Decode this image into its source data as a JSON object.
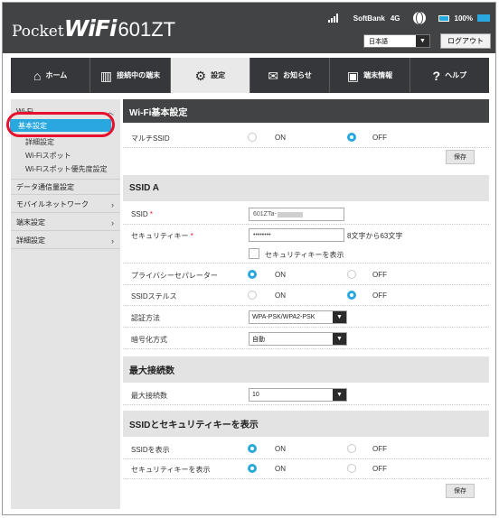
{
  "brand": {
    "pocket": "Pocket",
    "wifi": "WiFi",
    "model": "601ZT"
  },
  "status": {
    "carrier": "SoftBank",
    "network": "4G",
    "battery": "100%"
  },
  "header": {
    "language": "日本語",
    "logout": "ログアウト"
  },
  "nav": [
    {
      "label": "ホーム",
      "icon": "home-icon",
      "glyph": "⌂"
    },
    {
      "label": "接続中の端末",
      "icon": "devices-icon",
      "glyph": "▥"
    },
    {
      "label": "設定",
      "icon": "gear-icon",
      "glyph": "⚙"
    },
    {
      "label": "お知らせ",
      "icon": "mail-icon",
      "glyph": "✉"
    },
    {
      "label": "端末情報",
      "icon": "device-info-icon",
      "glyph": "▣"
    },
    {
      "label": "ヘルプ",
      "icon": "help-icon",
      "glyph": "?"
    }
  ],
  "sidebar": {
    "wifi": "Wi-Fi",
    "sub": [
      "基本設定",
      "詳細設定",
      "Wi-Fiスポット",
      "Wi-Fiスポット優先度設定"
    ],
    "data_usage": "データ通信量設定",
    "mobile_network": "モバイルネットワーク",
    "device_settings": "端末設定",
    "advanced": "詳細設定"
  },
  "main": {
    "wifi_basic": {
      "title": "Wi-Fi基本設定",
      "multi_ssid": "マルチSSID",
      "on": "ON",
      "off": "OFF",
      "multi_ssid_value": "OFF",
      "save": "保存"
    },
    "ssid_a": {
      "title": "SSID A",
      "ssid_label": "SSID",
      "ssid_value": "601ZTa-",
      "required": "*",
      "key_label": "セキュリティキー",
      "key_value": "••••••••",
      "key_hint": "8文字から63文字",
      "show_key": "セキュリティキーを表示",
      "show_key_checked": false,
      "privacy_label": "プライバシーセパレーター",
      "privacy_value": "ON",
      "stealth_label": "SSIDステルス",
      "stealth_value": "OFF",
      "auth_label": "認証方法",
      "auth_value": "WPA-PSK/WPA2-PSK",
      "enc_label": "暗号化方式",
      "enc_value": "自動"
    },
    "max_conn": {
      "title": "最大接続数",
      "label": "最大接続数",
      "value": "10"
    },
    "display": {
      "title": "SSIDとセキュリティキーを表示",
      "ssid_label": "SSIDを表示",
      "ssid_value": "ON",
      "key_label": "セキュリティキーを表示",
      "key_value": "ON",
      "save": "保存"
    }
  },
  "colors": {
    "accent": "#29a8e0",
    "header_bg": "#414345",
    "callout": "#e8112d"
  }
}
